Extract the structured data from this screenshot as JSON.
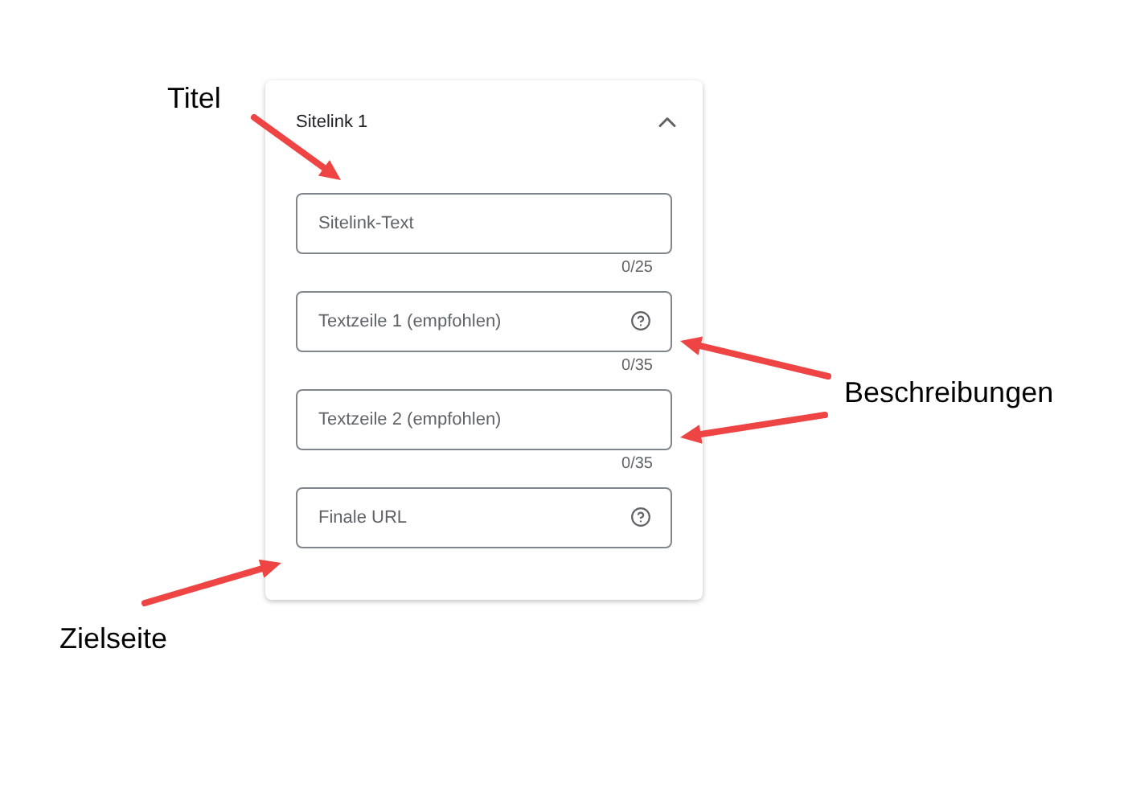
{
  "card": {
    "title": "Sitelink 1",
    "expanded": true,
    "fields": [
      {
        "placeholder": "Sitelink-Text",
        "counter": "0/25",
        "help": false
      },
      {
        "placeholder": "Textzeile 1 (empfohlen)",
        "counter": "0/35",
        "help": true
      },
      {
        "placeholder": "Textzeile 2 (empfohlen)",
        "counter": "0/35",
        "help": false
      },
      {
        "placeholder": "Finale URL",
        "help": true
      }
    ]
  },
  "annotations": [
    {
      "label": "Titel"
    },
    {
      "label": "Beschreibungen"
    },
    {
      "label": "Zielseite"
    }
  ]
}
